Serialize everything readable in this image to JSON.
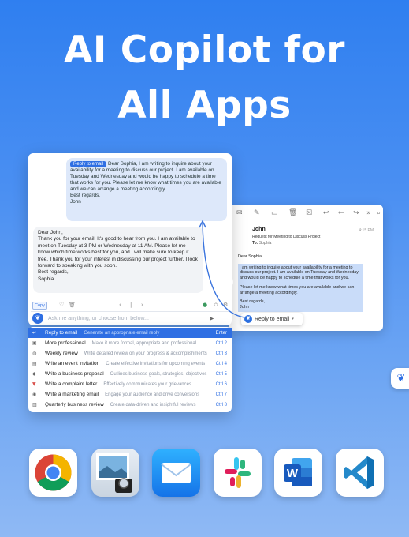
{
  "hero": {
    "line1": "AI Copilot for",
    "line2": "All Apps"
  },
  "mail": {
    "sender": "John",
    "time": "4:15 PM",
    "subject": "Request for Meeting to Discuss Project",
    "to_label": "To:",
    "to_value": "Sophia",
    "body_greeting": "Dear Sophia,",
    "body_highlight": "I am writing to inquire about your availability for a meeting to discuss our project. I am available on Tuesday and Wednesday and would be happy to schedule a time that works for you.",
    "body_highlight2": "Please let me know what times you are available and we can arrange a meeting accordingly.",
    "body_signoff": "Best regards,",
    "body_name": "John",
    "reply_chip_label": "Reply to email"
  },
  "copilot": {
    "user_tag": "Reply to email",
    "user_message": "Dear Sophia, I am writing to inquire about your availability for a meeting to discuss our project. I am available on Tuesday and Wednesday and would be happy to schedule a time that works for you. Please let me know what times you are available and we can arrange a meeting accordingly.",
    "user_signoff": "Best regards,",
    "user_name": "John",
    "ai_greeting": "Dear John,",
    "ai_message": "Thank you for your email. It's good to hear from you. I am available to meet on Tuesday at 3 PM or Wednesday at 11 AM. Please let me know which time works best for you, and I will make sure to keep it free. Thank you for your interest in discussing our project further. I look forward to speaking with you soon.",
    "ai_signoff": "Best regards,",
    "ai_name": "Sophia",
    "copy_label": "Copy",
    "input_placeholder": "Ask me anything, or choose from below..."
  },
  "prompts": [
    {
      "name": "Reply to email",
      "desc": "Generate an appropriate email reply",
      "key": "Enter",
      "icon": "reply-icon"
    },
    {
      "name": "More professional",
      "desc": "Make it more formal, appropriate and professional",
      "key": "Ctrl 2",
      "icon": "briefcase-icon"
    },
    {
      "name": "Weekly review",
      "desc": "Write detailed review on your progress & accomplishments",
      "key": "Ctrl 3",
      "icon": "review-icon"
    },
    {
      "name": "Write an event invitation",
      "desc": "Create effective invitations for upcoming events",
      "key": "Ctrl 4",
      "icon": "calendar-icon"
    },
    {
      "name": "Write a business proposal",
      "desc": "Outlines business goals, strategies, objectives",
      "key": "Ctrl 5",
      "icon": "proposal-icon"
    },
    {
      "name": "Write a complaint letter",
      "desc": "Effectively communicates your grievances",
      "key": "Ctrl 6",
      "icon": "complaint-icon"
    },
    {
      "name": "Write a marketing email",
      "desc": "Engage your audience and drive conversions",
      "key": "Ctrl 7",
      "icon": "marketing-icon"
    },
    {
      "name": "Quarterly business review",
      "desc": "Create data-driven and insightful reviews",
      "key": "Ctrl 8",
      "icon": "chart-icon"
    }
  ],
  "dock_apps": [
    "chrome-icon",
    "preview-icon",
    "mail-icon",
    "slack-icon",
    "word-icon",
    "vscode-icon"
  ],
  "colors": {
    "accent": "#2f6fe3",
    "bg_top": "#2f7ff0",
    "bg_bottom": "#8fb9f4"
  }
}
